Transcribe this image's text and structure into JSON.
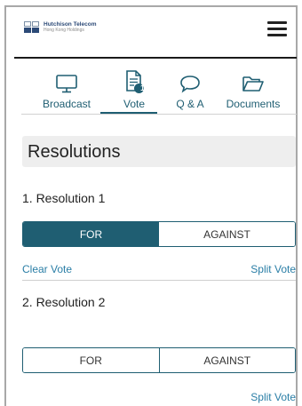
{
  "header": {
    "logo_name": "Hutchison Telecom",
    "logo_sub": "Hong Kong Holdings"
  },
  "tabs": [
    {
      "label": "Broadcast",
      "icon": "monitor-icon"
    },
    {
      "label": "Vote",
      "icon": "document-icon",
      "badge": "1",
      "active": true
    },
    {
      "label": "Q & A",
      "icon": "chat-bubble-icon"
    },
    {
      "label": "Documents",
      "icon": "folder-icon"
    }
  ],
  "section": {
    "title": "Resolutions"
  },
  "resolutions": [
    {
      "title": "1. Resolution 1",
      "for_label": "FOR",
      "against_label": "AGAINST",
      "selected": "FOR",
      "clear_label": "Clear Vote",
      "split_label": "Split Vote"
    },
    {
      "title": "2. Resolution 2",
      "for_label": "FOR",
      "against_label": "AGAINST",
      "selected": null,
      "split_label": "Split Vote"
    }
  ],
  "colors": {
    "accent": "#1f5e72",
    "link": "#2a7ea6"
  }
}
